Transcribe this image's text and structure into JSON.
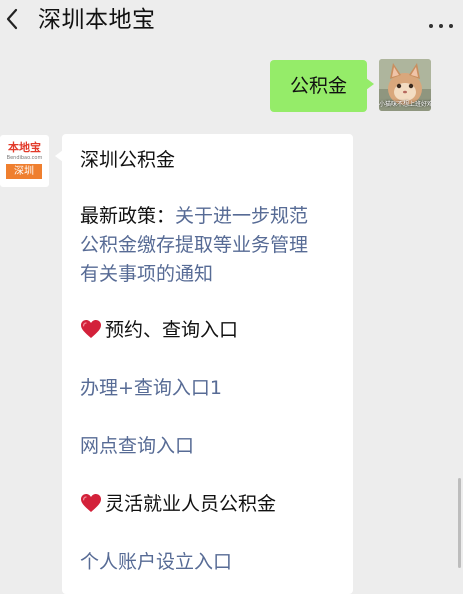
{
  "header": {
    "title": "深圳本地宝"
  },
  "outgoing": {
    "text": "公积金",
    "avatar_caption": "小猫咪不想上班好难"
  },
  "bot": {
    "logo_text": "本地宝",
    "logo_url": "Bendibao.com",
    "logo_tag": "深圳"
  },
  "reply": {
    "title": "深圳公积金",
    "policy_label": "最新政策：",
    "policy_link_lines": [
      "关于进一步规范",
      "公积金缴存提取等业务管理",
      "有关事项的通知"
    ],
    "section1_title": "预约、查询入口",
    "link1": "办理+查询入口1",
    "link2": "网点查询入口",
    "section2_title": "灵活就业人员公积金",
    "link3": "个人账户设立入口"
  },
  "colors": {
    "background": "#ededed",
    "bubble_out": "#95ec69",
    "link": "#576b95",
    "heart": "#d3213a"
  }
}
